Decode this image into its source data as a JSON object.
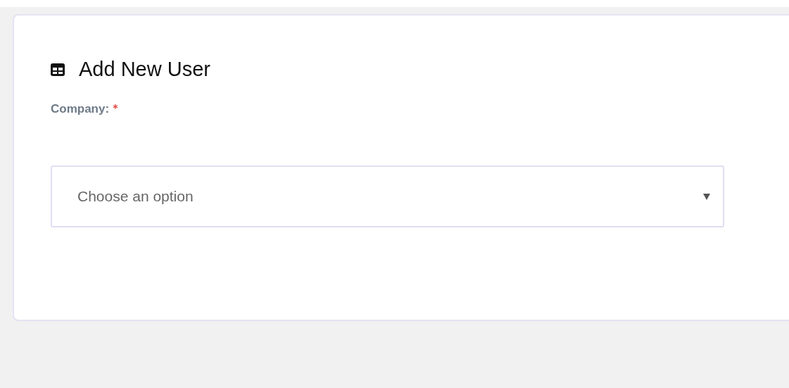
{
  "card": {
    "title": "Add New User"
  },
  "form": {
    "company": {
      "label": "Company:",
      "required": true,
      "required_mark": "*",
      "placeholder": "Choose an option"
    }
  }
}
